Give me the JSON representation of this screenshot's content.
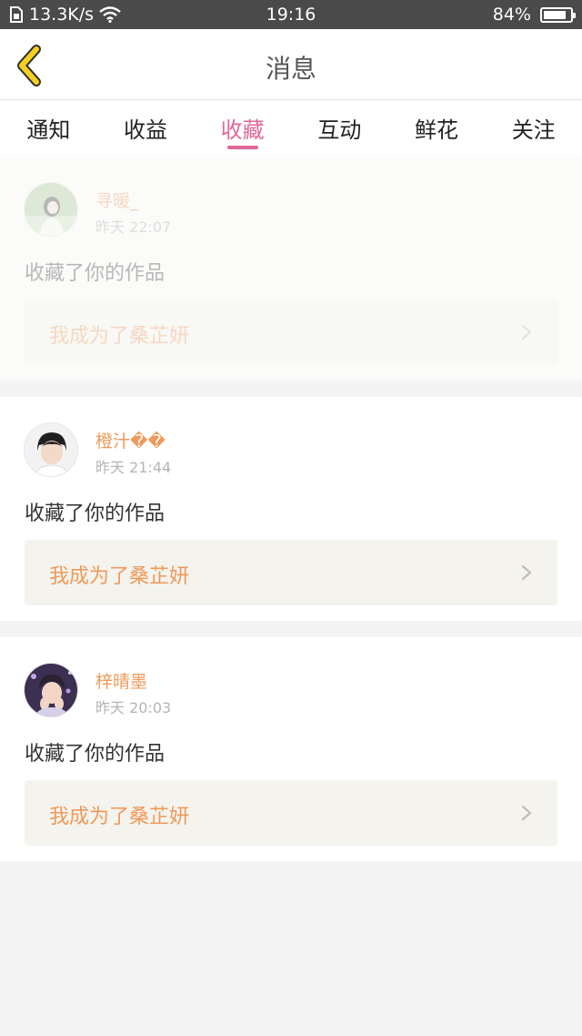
{
  "status_bar": {
    "network_speed": "13.3K/s",
    "time": "19:16",
    "battery": "84%",
    "battery_level": 0.84,
    "icons": [
      "sim-icon",
      "wifi-icon",
      "battery-icon"
    ]
  },
  "header": {
    "title": "消息",
    "back_icon": "chevron-left-icon",
    "accent_color": "#f5d020"
  },
  "tabs": [
    {
      "label": "通知",
      "active": false
    },
    {
      "label": "收益",
      "active": false
    },
    {
      "label": "收藏",
      "active": true
    },
    {
      "label": "互动",
      "active": false
    },
    {
      "label": "鲜花",
      "active": false
    },
    {
      "label": "关注",
      "active": false
    }
  ],
  "colors": {
    "active_tab": "#e0689a",
    "username": "#ee9a5a",
    "link_background": "#f4f3ee"
  },
  "messages": [
    {
      "user": "寻暖_",
      "time": "昨天 22:07",
      "action": "收藏了你的作品",
      "work": "我成为了桑芷妍",
      "faded": true,
      "avatar_icon": "avatar-girl-photo"
    },
    {
      "user": "橙汁��",
      "time": "昨天 21:44",
      "action": "收藏了你的作品",
      "work": "我成为了桑芷妍",
      "faded": false,
      "avatar_icon": "avatar-boy-photo"
    },
    {
      "user": "梓晴墨",
      "time": "昨天 20:03",
      "action": "收藏了你的作品",
      "work": "我成为了桑芷妍",
      "faded": false,
      "avatar_icon": "avatar-boy-photo"
    }
  ]
}
